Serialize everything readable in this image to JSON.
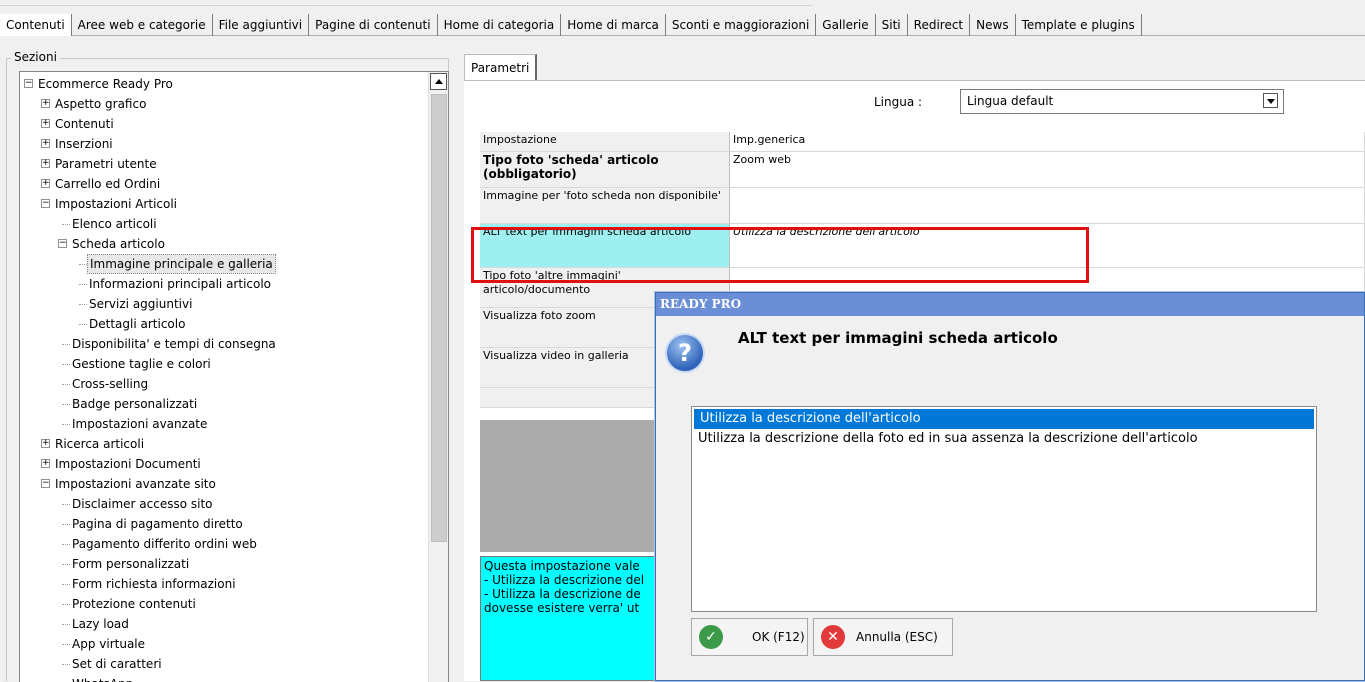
{
  "tabs": [
    {
      "label": "Contenuti",
      "active": true
    },
    {
      "label": "Aree web e categorie"
    },
    {
      "label": "File aggiuntivi"
    },
    {
      "label": "Pagine di contenuti"
    },
    {
      "label": "Home di categoria"
    },
    {
      "label": "Home di marca"
    },
    {
      "label": "Sconti e maggiorazioni"
    },
    {
      "label": "Gallerie"
    },
    {
      "label": "Siti"
    },
    {
      "label": "Redirect"
    },
    {
      "label": "News"
    },
    {
      "label": "Template e plugins"
    }
  ],
  "sections": {
    "legend": "Sezioni",
    "tree": [
      {
        "label": "Ecommerce Ready Pro",
        "level": 0,
        "exp": "-"
      },
      {
        "label": "Aspetto grafico",
        "level": 1,
        "exp": "+"
      },
      {
        "label": "Contenuti",
        "level": 1,
        "exp": "+"
      },
      {
        "label": "Inserzioni",
        "level": 1,
        "exp": "+"
      },
      {
        "label": "Parametri utente",
        "level": 1,
        "exp": "+"
      },
      {
        "label": "Carrello ed Ordini",
        "level": 1,
        "exp": "+"
      },
      {
        "label": "Impostazioni Articoli",
        "level": 1,
        "exp": "-"
      },
      {
        "label": "Elenco articoli",
        "level": 2
      },
      {
        "label": "Scheda articolo",
        "level": 2,
        "exp": "-"
      },
      {
        "label": "Immagine principale e galleria",
        "level": 3,
        "selected": true
      },
      {
        "label": "Informazioni principali articolo",
        "level": 3
      },
      {
        "label": "Servizi aggiuntivi",
        "level": 3
      },
      {
        "label": "Dettagli articolo",
        "level": 3
      },
      {
        "label": "Disponibilita' e tempi di consegna",
        "level": 2
      },
      {
        "label": "Gestione taglie e colori",
        "level": 2
      },
      {
        "label": "Cross-selling",
        "level": 2
      },
      {
        "label": "Badge personalizzati",
        "level": 2
      },
      {
        "label": "Impostazioni avanzate",
        "level": 2
      },
      {
        "label": "Ricerca articoli",
        "level": 1,
        "exp": "+"
      },
      {
        "label": "Impostazioni Documenti",
        "level": 1,
        "exp": "+"
      },
      {
        "label": "Impostazioni avanzate sito",
        "level": 1,
        "exp": "-"
      },
      {
        "label": "Disclaimer accesso sito",
        "level": 2
      },
      {
        "label": "Pagina di pagamento diretto",
        "level": 2
      },
      {
        "label": "Pagamento differito ordini web",
        "level": 2
      },
      {
        "label": "Form personalizzati",
        "level": 2
      },
      {
        "label": "Form richiesta informazioni",
        "level": 2
      },
      {
        "label": "Protezione contenuti",
        "level": 2
      },
      {
        "label": "Lazy load",
        "level": 2
      },
      {
        "label": "App virtuale",
        "level": 2
      },
      {
        "label": "Set di caratteri",
        "level": 2
      },
      {
        "label": "WhatsApp",
        "level": 2
      }
    ]
  },
  "params": {
    "tab_label": "Parametri",
    "lingua_label": "Lingua :",
    "lingua_value": "Lingua default",
    "grid_header": [
      "Impostazione",
      "Imp.generica"
    ],
    "rows": [
      {
        "key": "Tipo foto 'scheda' articolo (obbligatorio)",
        "value": "Zoom web",
        "bold": true
      },
      {
        "key": "Immagine per 'foto scheda non disponibile'",
        "value": ""
      },
      {
        "key": "ALT text per immagini scheda articolo",
        "value": "Utilizza la descrizione dell'articolo",
        "highlight": true
      },
      {
        "key": "Tipo foto 'altre immagini' articolo/documento",
        "value": ""
      },
      {
        "key": "Visualizza foto zoom",
        "value": ""
      },
      {
        "key": "Visualizza video in galleria",
        "value": ""
      },
      {
        "key": "",
        "value": ""
      }
    ],
    "description": "Questa impostazione vale\n- Utilizza la descrizione del\n- Utilizza la descrizione de\ndovesse esistere verra' ut"
  },
  "dialog": {
    "title": "READY PRO",
    "heading": "ALT text per immagini scheda articolo",
    "icon": "question-icon",
    "options": [
      "Utilizza la descrizione dell'articolo",
      "Utilizza la descrizione della foto ed in sua assenza la descrizione dell'articolo"
    ],
    "selected_index": 0,
    "ok_label": "OK (F12)",
    "cancel_label": "Annulla (ESC)"
  },
  "colors": {
    "highlight_cyan": "#9ef0f0",
    "description_bg": "#00ffff",
    "annotation_red": "#e01010",
    "dialog_title_bg": "#6b8fd6",
    "selection_blue": "#0078d7"
  }
}
